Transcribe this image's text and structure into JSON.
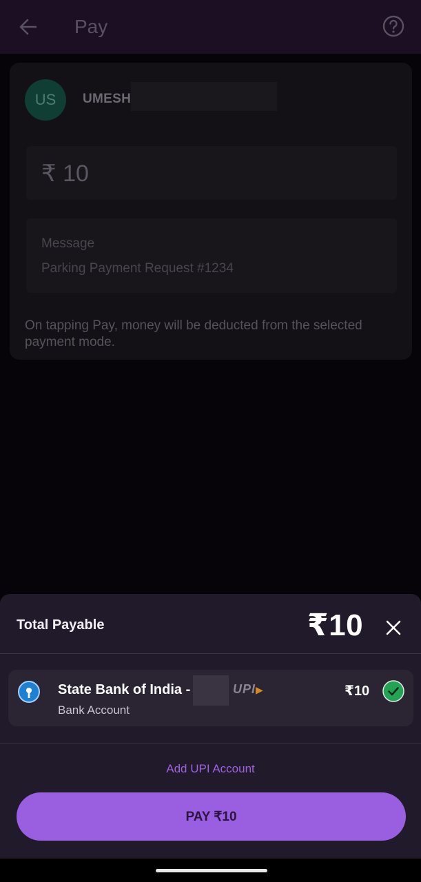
{
  "header": {
    "title": "Pay",
    "back_icon": "arrow-left-icon",
    "help_icon": "help-circle-icon"
  },
  "payee": {
    "initials": "US",
    "name": "UMESH"
  },
  "amount": {
    "display": "₹ 10"
  },
  "message": {
    "label": "Message",
    "value": "Parking Payment Request #1234"
  },
  "disclaimer": "On tapping Pay, money will be deducted from the selected payment mode.",
  "sheet": {
    "total_label": "Total Payable",
    "total_amount": "₹10",
    "close_icon": "close-icon",
    "account": {
      "bank_name": "State Bank of India -",
      "type": "Bank Account",
      "amount": "₹10",
      "upi_logo_text": "UPI",
      "selected": true,
      "bank_icon": "sbi-logo-icon",
      "check_icon": "check-circle-icon"
    },
    "add_upi_label": "Add UPI Account",
    "pay_button_label": "PAY ₹10"
  },
  "colors": {
    "accent": "#9a5ee0",
    "link": "#a061e0",
    "check_green": "#23a455",
    "sheet_bg": "#211a2a",
    "topbar_bg": "#1c0f24"
  }
}
